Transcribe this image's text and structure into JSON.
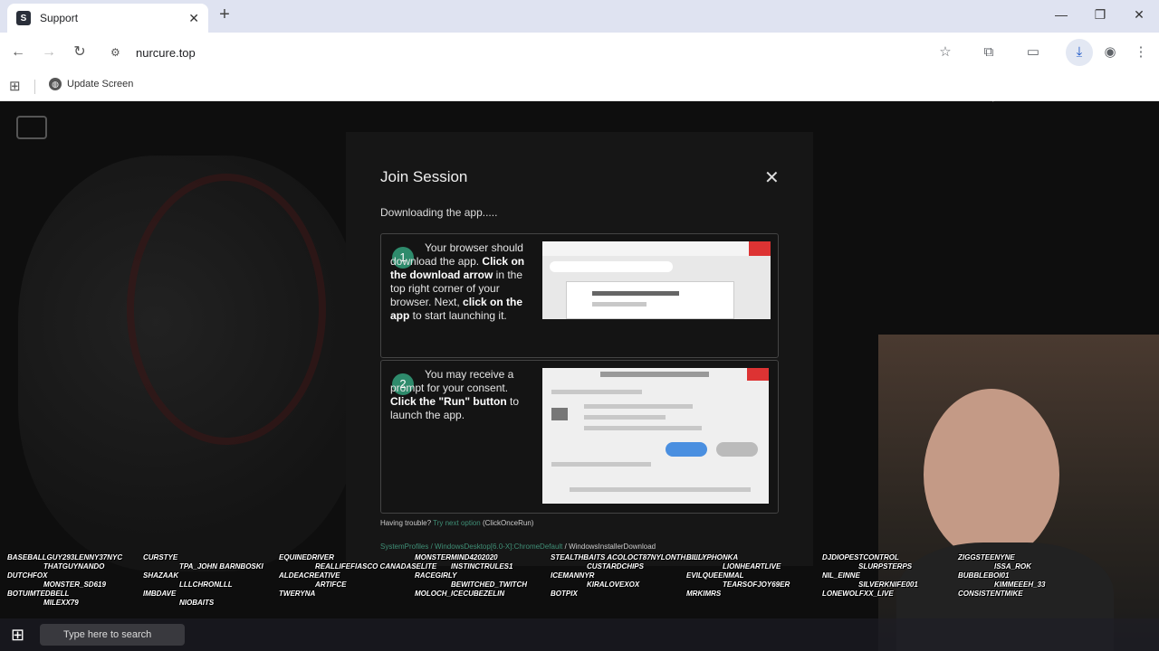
{
  "browser": {
    "tab": {
      "title": "Support",
      "favicon": "S"
    },
    "address_url": "nurcure.top",
    "bookmark": {
      "label": "Update Screen"
    }
  },
  "modal": {
    "title": "Join Session",
    "subtitle": "Downloading the app.....",
    "step1": {
      "number": "1",
      "text_a": "Your browser should download the app. ",
      "bold_a": "Click on the download arrow",
      "text_b": " in the top right corner of your browser. Next, ",
      "bold_b": "click on the app",
      "text_c": " to start launching it."
    },
    "step2": {
      "number": "2",
      "text_a": "You may receive a prompt for your consent. ",
      "bold_a": "Click the \"Run\" button",
      "text_b": " to launch the app."
    },
    "help": {
      "text": "Having trouble?",
      "link": "Try next option",
      "suffix": "(ClickOnceRun)"
    },
    "path": {
      "link": "SystemProfiles / WindowsDesktop[6.0-X]:ChromeDefault",
      "suffix": "/ WindowsInstallerDownload"
    }
  },
  "overlay_names": [
    "BASEBALLGUY293LENNY37NYC",
    "CURSTYE",
    "EQUINEDRIVER",
    "MONSTERMIND4202020",
    "STEALTHBAITS ACOLOCT87NYLONTHEBRAIN",
    "BILLYPHONKA",
    "DJDIOPESTCONTROL",
    "ZIGGSTEENYNE",
    "THATGUYNANDO",
    "TPA_JOHN BARNBOSKI",
    "REALLIFEFIASCO CANADASELITE",
    "INSTINCTRULES1",
    "CUSTARDCHIPS",
    "LIONHEARTLIVE",
    "SLURPSTERPS",
    "ISSA_ROK",
    "DUTCHFOX",
    "SHAZAAK",
    "ALDEACREATIVE",
    "RACEGIRLY",
    "ICEMANNYR",
    "EVILQUEENMAL",
    "NIL_EINNE",
    "BUBBLEBOI01",
    "MONSTER_SD619",
    "LLLCHRONLLL",
    "ARTIFCE",
    "BEWITCHED_TWITCH",
    "KIRALOVEXOX",
    "TEARSOFJOY69ER",
    "SILVERKNIFE001",
    "KIMMEEEH_33",
    "BOTUIMTEDBELL",
    "IMBDAVE",
    "TWERYNA",
    "MOLOCH_ICECUBEZELIN",
    "BOTPIX",
    "MRKIMRS",
    "LONEWOLFXX_LIVE",
    "CONSISTENTMIKE",
    "MILEXX79",
    "NIOBAITS"
  ],
  "taskbar": {
    "search_placeholder": "Type here to search"
  }
}
